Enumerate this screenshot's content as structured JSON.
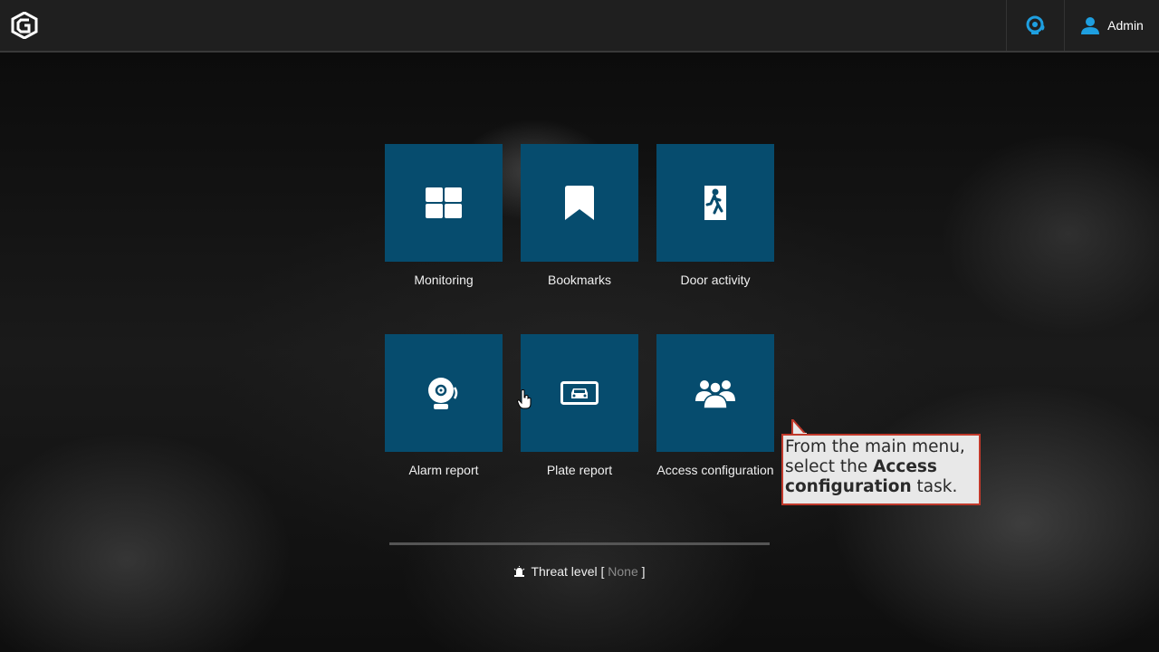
{
  "header": {
    "user_label": "Admin",
    "logo_icon": "genetec-logo-icon",
    "alarm_icon": "alarm-notification-icon",
    "user_icon": "user-icon",
    "accent_color": "#1e9fe0"
  },
  "tiles": [
    {
      "label": "Monitoring",
      "icon": "monitoring-grid-icon"
    },
    {
      "label": "Bookmarks",
      "icon": "bookmark-icon"
    },
    {
      "label": "Door activity",
      "icon": "door-exit-icon"
    },
    {
      "label": "Alarm report",
      "icon": "alarm-bell-icon"
    },
    {
      "label": "Plate report",
      "icon": "license-plate-car-icon"
    },
    {
      "label": "Access configuration",
      "icon": "user-group-icon"
    }
  ],
  "tile_color": "#064c6e",
  "threat": {
    "label": "Threat level [",
    "value": "None",
    "close": "]",
    "icon": "siren-icon"
  },
  "callout": {
    "line1": "From the main menu,",
    "line2_prefix": "select the ",
    "line2_bold": "Access",
    "line3_bold": "configuration",
    "line3_suffix": " task."
  }
}
